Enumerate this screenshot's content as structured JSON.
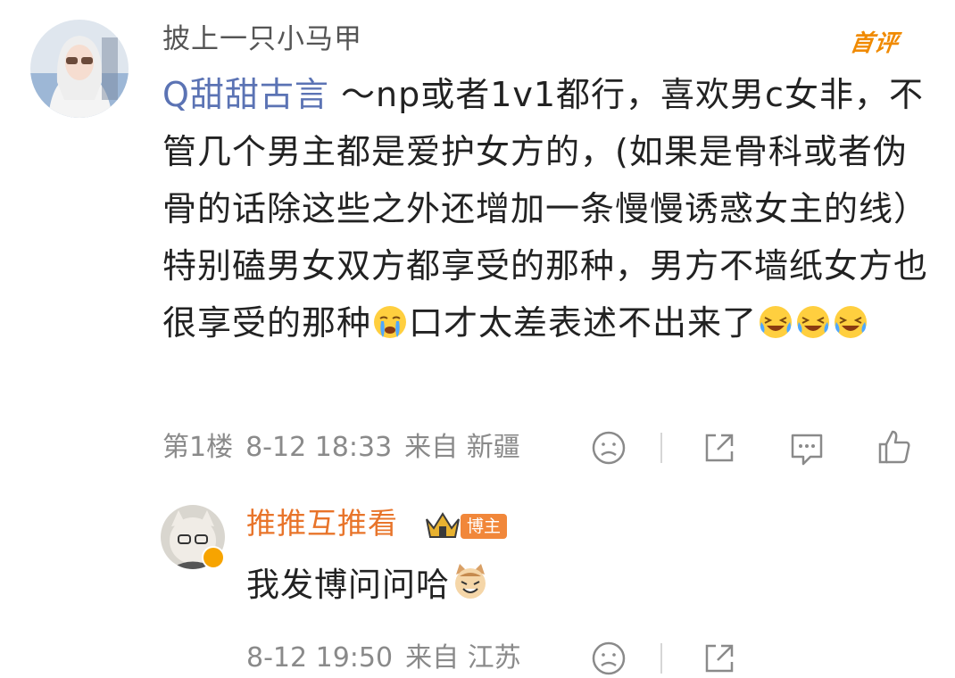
{
  "comment": {
    "username": "披上一只小马甲",
    "badge": "首评",
    "topic": "Q甜甜古言",
    "text_parts": [
      " ～np或者1v1都行，喜欢男c女非，不管几个男主都是爱护女方的，(如果是骨科或者伪骨的话除这些之外还增加一条慢慢诱惑女主的线）特别磕男女双方都享受的那种，男方不墙纸女方也很享受的那种",
      "口才太差表述不出来了"
    ],
    "emojis": [
      "crying-emoji",
      "laughing-crying-emoji",
      "laughing-crying-emoji",
      "laughing-crying-emoji"
    ],
    "floor": "第1楼",
    "time": "8-12 18:33",
    "location": "来自 新疆"
  },
  "reply": {
    "username": "推推互推看",
    "tag": "博主",
    "text": "我发博问问哈",
    "emoji": "cat-emoji",
    "time": "8-12 19:50",
    "location": "来自 江苏"
  },
  "actions": [
    "dislike-icon",
    "share-icon",
    "comment-icon",
    "like-icon"
  ],
  "colors": {
    "accent_orange": "#e8742a",
    "topic_blue": "#5b73b4",
    "meta_gray": "#8a8a8a",
    "first_badge": "#f08a00"
  }
}
